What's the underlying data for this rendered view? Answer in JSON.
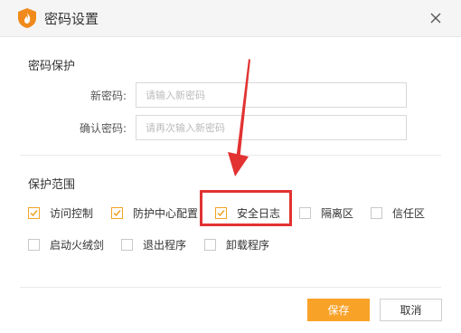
{
  "window": {
    "title": "密码设置"
  },
  "password_section": {
    "title": "密码保护",
    "new_password": {
      "label": "新密码:",
      "placeholder": "请输入新密码",
      "value": ""
    },
    "confirm_password": {
      "label": "确认密码:",
      "placeholder": "请再次输入新密码",
      "value": ""
    }
  },
  "scope_section": {
    "title": "保护范围",
    "options": [
      {
        "label": "访问控制",
        "checked": true
      },
      {
        "label": "防护中心配置",
        "checked": true
      },
      {
        "label": "安全日志",
        "checked": true
      },
      {
        "label": "隔离区",
        "checked": false
      },
      {
        "label": "信任区",
        "checked": false
      },
      {
        "label": "启动火绒剑",
        "checked": false
      },
      {
        "label": "退出程序",
        "checked": false
      },
      {
        "label": "卸载程序",
        "checked": false
      }
    ]
  },
  "footer": {
    "save_label": "保存",
    "cancel_label": "取消"
  },
  "colors": {
    "accent": "#f9a228",
    "checkbox_border_checked": "#f2a325",
    "annotation": "#e23232"
  },
  "icons": {
    "logo": "fire-shield-logo-icon",
    "close": "close-icon",
    "check": "checkmark-icon",
    "annotation_arrow": "red-arrow-icon"
  }
}
